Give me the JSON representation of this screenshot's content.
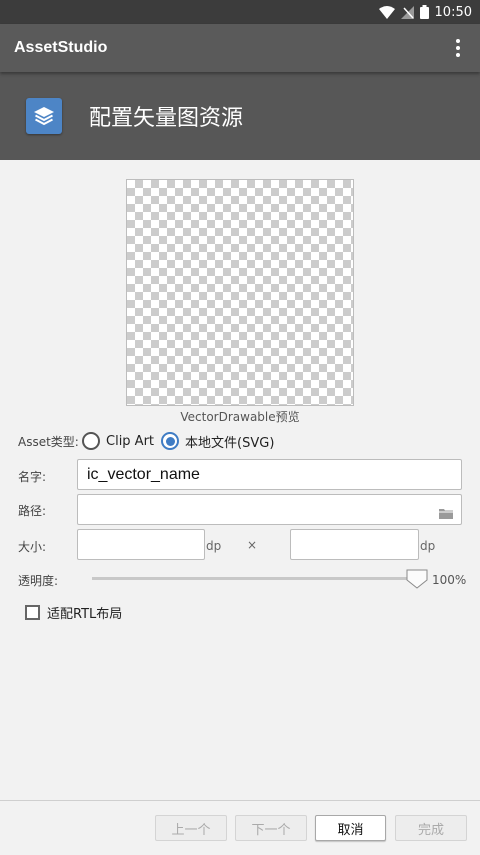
{
  "status_bar": {
    "time": "10:50"
  },
  "app_bar": {
    "title": "AssetStudio",
    "menu_icon": "more-vert-icon"
  },
  "header": {
    "title": "配置矢量图资源",
    "icon": "layers-icon"
  },
  "preview": {
    "caption": "VectorDrawable预览"
  },
  "asset_type": {
    "label": "Asset类型:",
    "options": [
      {
        "label": "Clip Art",
        "selected": false
      },
      {
        "label": "本地文件(SVG)",
        "selected": true
      }
    ]
  },
  "name_field": {
    "label": "名字:",
    "value": "ic_vector_name"
  },
  "path_field": {
    "label": "路径:",
    "value": "",
    "icon": "folder-icon"
  },
  "size": {
    "label": "大小:",
    "width_value": "",
    "height_value": "",
    "unit": "dp",
    "separator": "×"
  },
  "opacity": {
    "label": "透明度:",
    "value_text": "100%",
    "value": 100
  },
  "rtl": {
    "label": "适配RTL布局",
    "checked": false
  },
  "footer": {
    "prev": "上一个",
    "next": "下一个",
    "cancel": "取消",
    "finish": "完成"
  },
  "colors": {
    "accent": "#3f7cc4",
    "app_bar": "#5a5a5a",
    "header_bg": "#575757",
    "header_icon_bg": "#4d85c6"
  }
}
